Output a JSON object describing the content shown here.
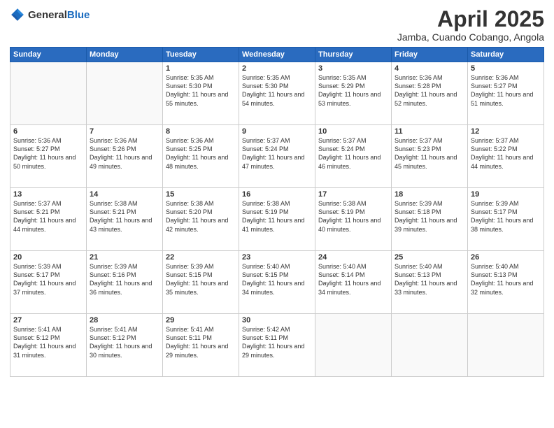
{
  "header": {
    "logo": {
      "general": "General",
      "blue": "Blue"
    },
    "title": "April 2025",
    "location": "Jamba, Cuando Cobango, Angola"
  },
  "days": [
    "Sunday",
    "Monday",
    "Tuesday",
    "Wednesday",
    "Thursday",
    "Friday",
    "Saturday"
  ],
  "weeks": [
    [
      {
        "day": "",
        "info": ""
      },
      {
        "day": "",
        "info": ""
      },
      {
        "day": "1",
        "info": "Sunrise: 5:35 AM\nSunset: 5:30 PM\nDaylight: 11 hours and 55 minutes."
      },
      {
        "day": "2",
        "info": "Sunrise: 5:35 AM\nSunset: 5:30 PM\nDaylight: 11 hours and 54 minutes."
      },
      {
        "day": "3",
        "info": "Sunrise: 5:35 AM\nSunset: 5:29 PM\nDaylight: 11 hours and 53 minutes."
      },
      {
        "day": "4",
        "info": "Sunrise: 5:36 AM\nSunset: 5:28 PM\nDaylight: 11 hours and 52 minutes."
      },
      {
        "day": "5",
        "info": "Sunrise: 5:36 AM\nSunset: 5:27 PM\nDaylight: 11 hours and 51 minutes."
      }
    ],
    [
      {
        "day": "6",
        "info": "Sunrise: 5:36 AM\nSunset: 5:27 PM\nDaylight: 11 hours and 50 minutes."
      },
      {
        "day": "7",
        "info": "Sunrise: 5:36 AM\nSunset: 5:26 PM\nDaylight: 11 hours and 49 minutes."
      },
      {
        "day": "8",
        "info": "Sunrise: 5:36 AM\nSunset: 5:25 PM\nDaylight: 11 hours and 48 minutes."
      },
      {
        "day": "9",
        "info": "Sunrise: 5:37 AM\nSunset: 5:24 PM\nDaylight: 11 hours and 47 minutes."
      },
      {
        "day": "10",
        "info": "Sunrise: 5:37 AM\nSunset: 5:24 PM\nDaylight: 11 hours and 46 minutes."
      },
      {
        "day": "11",
        "info": "Sunrise: 5:37 AM\nSunset: 5:23 PM\nDaylight: 11 hours and 45 minutes."
      },
      {
        "day": "12",
        "info": "Sunrise: 5:37 AM\nSunset: 5:22 PM\nDaylight: 11 hours and 44 minutes."
      }
    ],
    [
      {
        "day": "13",
        "info": "Sunrise: 5:37 AM\nSunset: 5:21 PM\nDaylight: 11 hours and 44 minutes."
      },
      {
        "day": "14",
        "info": "Sunrise: 5:38 AM\nSunset: 5:21 PM\nDaylight: 11 hours and 43 minutes."
      },
      {
        "day": "15",
        "info": "Sunrise: 5:38 AM\nSunset: 5:20 PM\nDaylight: 11 hours and 42 minutes."
      },
      {
        "day": "16",
        "info": "Sunrise: 5:38 AM\nSunset: 5:19 PM\nDaylight: 11 hours and 41 minutes."
      },
      {
        "day": "17",
        "info": "Sunrise: 5:38 AM\nSunset: 5:19 PM\nDaylight: 11 hours and 40 minutes."
      },
      {
        "day": "18",
        "info": "Sunrise: 5:39 AM\nSunset: 5:18 PM\nDaylight: 11 hours and 39 minutes."
      },
      {
        "day": "19",
        "info": "Sunrise: 5:39 AM\nSunset: 5:17 PM\nDaylight: 11 hours and 38 minutes."
      }
    ],
    [
      {
        "day": "20",
        "info": "Sunrise: 5:39 AM\nSunset: 5:17 PM\nDaylight: 11 hours and 37 minutes."
      },
      {
        "day": "21",
        "info": "Sunrise: 5:39 AM\nSunset: 5:16 PM\nDaylight: 11 hours and 36 minutes."
      },
      {
        "day": "22",
        "info": "Sunrise: 5:39 AM\nSunset: 5:15 PM\nDaylight: 11 hours and 35 minutes."
      },
      {
        "day": "23",
        "info": "Sunrise: 5:40 AM\nSunset: 5:15 PM\nDaylight: 11 hours and 34 minutes."
      },
      {
        "day": "24",
        "info": "Sunrise: 5:40 AM\nSunset: 5:14 PM\nDaylight: 11 hours and 34 minutes."
      },
      {
        "day": "25",
        "info": "Sunrise: 5:40 AM\nSunset: 5:13 PM\nDaylight: 11 hours and 33 minutes."
      },
      {
        "day": "26",
        "info": "Sunrise: 5:40 AM\nSunset: 5:13 PM\nDaylight: 11 hours and 32 minutes."
      }
    ],
    [
      {
        "day": "27",
        "info": "Sunrise: 5:41 AM\nSunset: 5:12 PM\nDaylight: 11 hours and 31 minutes."
      },
      {
        "day": "28",
        "info": "Sunrise: 5:41 AM\nSunset: 5:12 PM\nDaylight: 11 hours and 30 minutes."
      },
      {
        "day": "29",
        "info": "Sunrise: 5:41 AM\nSunset: 5:11 PM\nDaylight: 11 hours and 29 minutes."
      },
      {
        "day": "30",
        "info": "Sunrise: 5:42 AM\nSunset: 5:11 PM\nDaylight: 11 hours and 29 minutes."
      },
      {
        "day": "",
        "info": ""
      },
      {
        "day": "",
        "info": ""
      },
      {
        "day": "",
        "info": ""
      }
    ]
  ]
}
